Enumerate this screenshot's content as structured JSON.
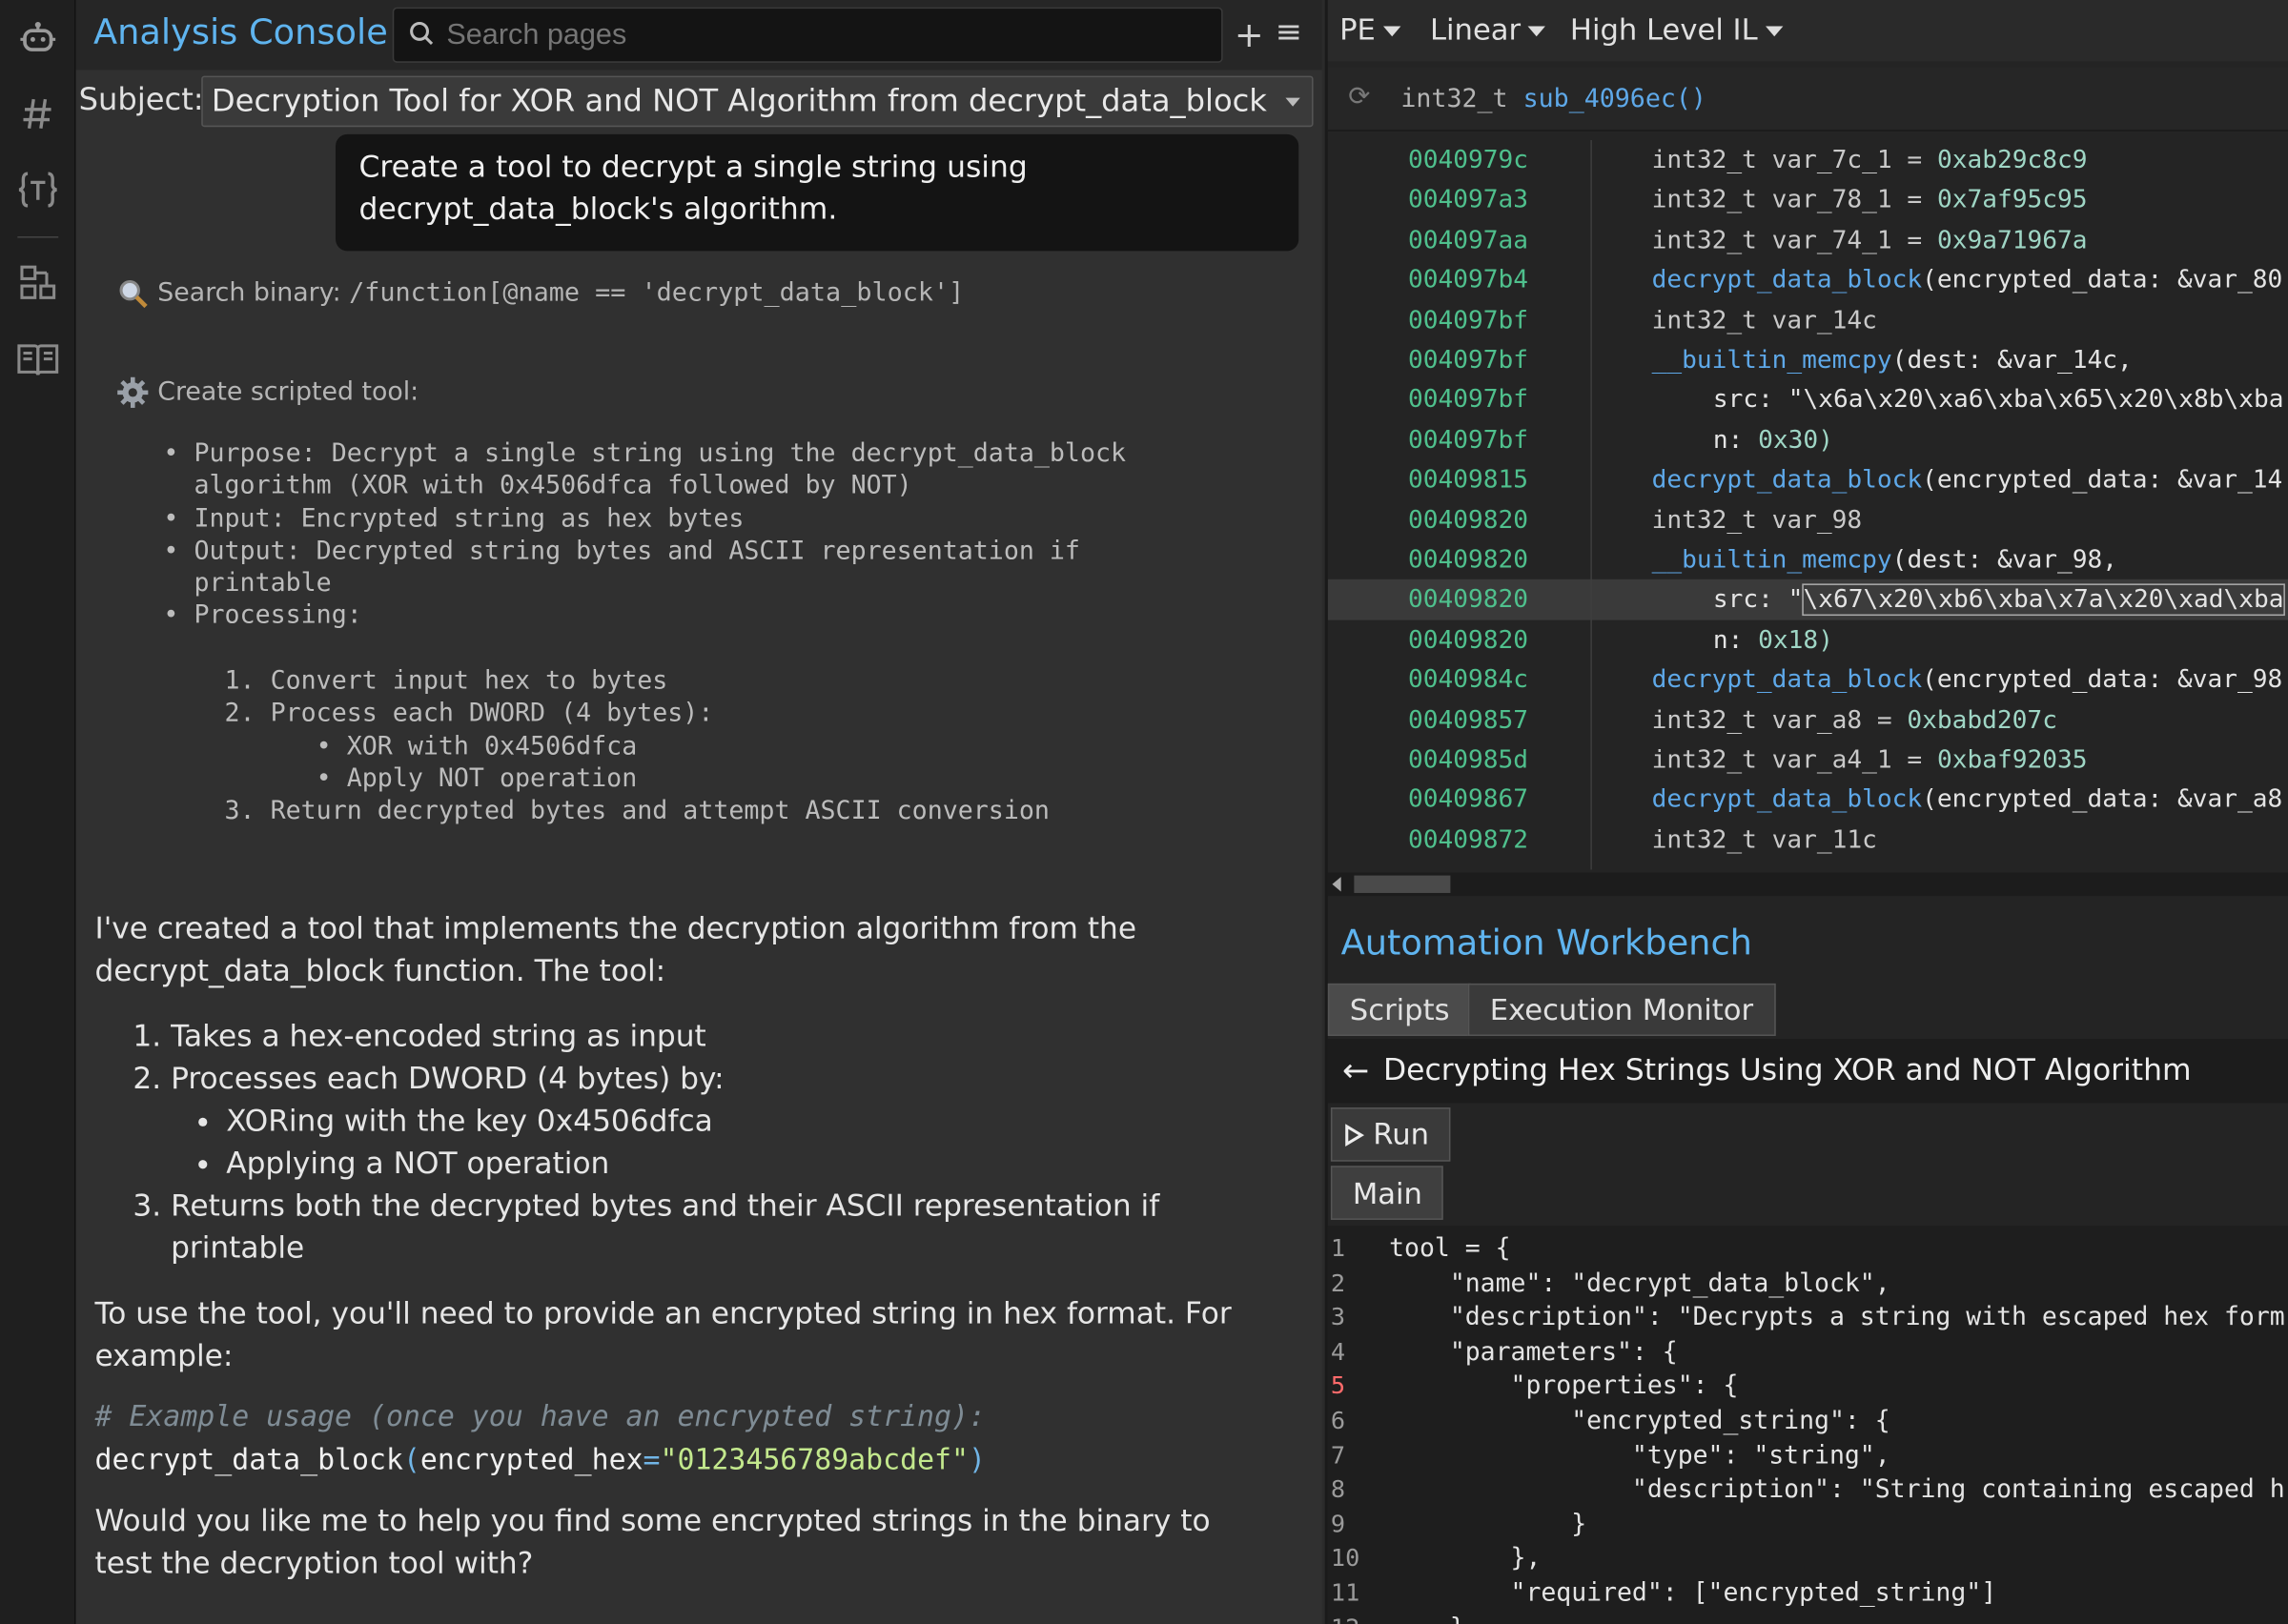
{
  "app": {
    "title": "Analysis Console",
    "search_placeholder": "Search pages",
    "plus": "+",
    "menu": "≡"
  },
  "rail": {
    "icons": [
      "robot-icon",
      "hash-icon",
      "braces-icon",
      "graph-icon",
      "book-icon"
    ]
  },
  "subject": {
    "label": "Subject:",
    "value": "Decryption Tool for XOR and NOT Algorithm from decrypt_data_block"
  },
  "chat": {
    "user_message": "Create a tool to decrypt a single string using decrypt_data_block's algorithm.",
    "step1_label": "Search binary: ",
    "step1_query": "/function[@name == 'decrypt_data_block']",
    "step2_label": "Create scripted tool:",
    "tool_spec": "• Purpose: Decrypt a single string using the decrypt_data_block\n  algorithm (XOR with 0x4506dfca followed by NOT)\n• Input: Encrypted string as hex bytes\n• Output: Decrypted string bytes and ASCII representation if\n  printable\n• Processing:\n\n    1. Convert input hex to bytes\n    2. Process each DWORD (4 bytes):\n          • XOR with 0x4506dfca\n          • Apply NOT operation\n    3. Return decrypted bytes and attempt ASCII conversion",
    "reply_intro": "I've created a tool that implements the decryption algorithm from the decrypt_data_block function. The tool:",
    "reply_items": {
      "i1": "Takes a hex-encoded string as input",
      "i2": "Processes each DWORD (4 bytes) by:",
      "i2a": "XORing with the key 0x4506dfca",
      "i2b": "Applying a NOT operation",
      "i3": "Returns both the decrypted bytes and their ASCII representation if printable"
    },
    "reply_usage": "To use the tool, you'll need to provide an encrypted string in hex format. For example:",
    "code_comment": "# Example usage (once you have an encrypted string):",
    "code_fn": "decrypt_data_block",
    "code_paren_open": "(",
    "code_param": "encrypted_hex",
    "code_eq": "=",
    "code_str": "\"0123456789abcdef\"",
    "code_paren_close": ")",
    "reply_question": "Would you like me to help you find some encrypted strings in the binary to test the decryption tool with?"
  },
  "viewer": {
    "format": "PE",
    "layout": "Linear",
    "il_level": "High Level IL",
    "func_type": "int32_t",
    "func_name": "sub_4096ec()",
    "rows": [
      {
        "addr": "0040979c",
        "p1": "int32_t var_7c_1 = ",
        "p2": "0xab29c8c9"
      },
      {
        "addr": "004097a3",
        "p1": "int32_t var_78_1 = ",
        "p2": "0x7af95c95"
      },
      {
        "addr": "004097aa",
        "p1": "int32_t var_74_1 = ",
        "p2": "0x9a71967a"
      },
      {
        "addr": "004097b4",
        "p1": "decrypt_data_block",
        "p2": "(encrypted_data: &var_80"
      },
      {
        "addr": "004097bf",
        "p1": "int32_t var_14c",
        "p2": ""
      },
      {
        "addr": "004097bf",
        "p1": "__builtin_memcpy",
        "p2": "(dest: &var_14c,"
      },
      {
        "addr": "004097bf",
        "p1": "src: ",
        "p2": "\"\\x6a\\x20\\xa6\\xba\\x65\\x20\\x8b\\xba"
      },
      {
        "addr": "004097bf",
        "p1": "n: ",
        "p2": "0x30)"
      },
      {
        "addr": "00409815",
        "p1": "decrypt_data_block",
        "p2": "(encrypted_data: &var_14"
      },
      {
        "addr": "00409820",
        "p1": "int32_t var_98",
        "p2": ""
      },
      {
        "addr": "00409820",
        "p1": "__builtin_memcpy",
        "p2": "(dest: &var_98,"
      },
      {
        "addr": "00409820",
        "p1": "src: \"",
        "p2": "\\x67\\x20\\xb6\\xba\\x7a\\x20\\xad\\xba"
      },
      {
        "addr": "00409820",
        "p1": "n: ",
        "p2": "0x18)"
      },
      {
        "addr": "0040984c",
        "p1": "decrypt_data_block",
        "p2": "(encrypted_data: &var_98"
      },
      {
        "addr": "00409857",
        "p1": "int32_t var_a8 = ",
        "p2": "0xbabd207c"
      },
      {
        "addr": "0040985d",
        "p1": "int32_t var_a4_1 = ",
        "p2": "0xbaf92035"
      },
      {
        "addr": "00409867",
        "p1": "decrypt_data_block",
        "p2": "(encrypted_data: &var_a8"
      },
      {
        "addr": "00409872",
        "p1": "int32_t var_11c",
        "p2": ""
      }
    ]
  },
  "workbench": {
    "title": "Automation Workbench",
    "tabs": [
      "Scripts",
      "Execution Monitor"
    ],
    "script_title": "Decrypting Hex Strings Using XOR and NOT Algorithm",
    "run_label": "Run",
    "main_tab": "Main",
    "editor_lines": [
      {
        "n": "1",
        "t": "tool = {"
      },
      {
        "n": "2",
        "t": "    \"name\": \"decrypt_data_block\","
      },
      {
        "n": "3",
        "t": "    \"description\": \"Decrypts a string with escaped hex form"
      },
      {
        "n": "4",
        "t": "    \"parameters\": {"
      },
      {
        "n": "5",
        "t": "        \"properties\": {"
      },
      {
        "n": "6",
        "t": "            \"encrypted_string\": {"
      },
      {
        "n": "7",
        "t": "                \"type\": \"string\","
      },
      {
        "n": "8",
        "t": "                \"description\": \"String containing escaped h"
      },
      {
        "n": "9",
        "t": "            }"
      },
      {
        "n": "10",
        "t": "        },"
      },
      {
        "n": "11",
        "t": "        \"required\": [\"encrypted_string\"]"
      },
      {
        "n": "12",
        "t": "    }"
      }
    ]
  }
}
